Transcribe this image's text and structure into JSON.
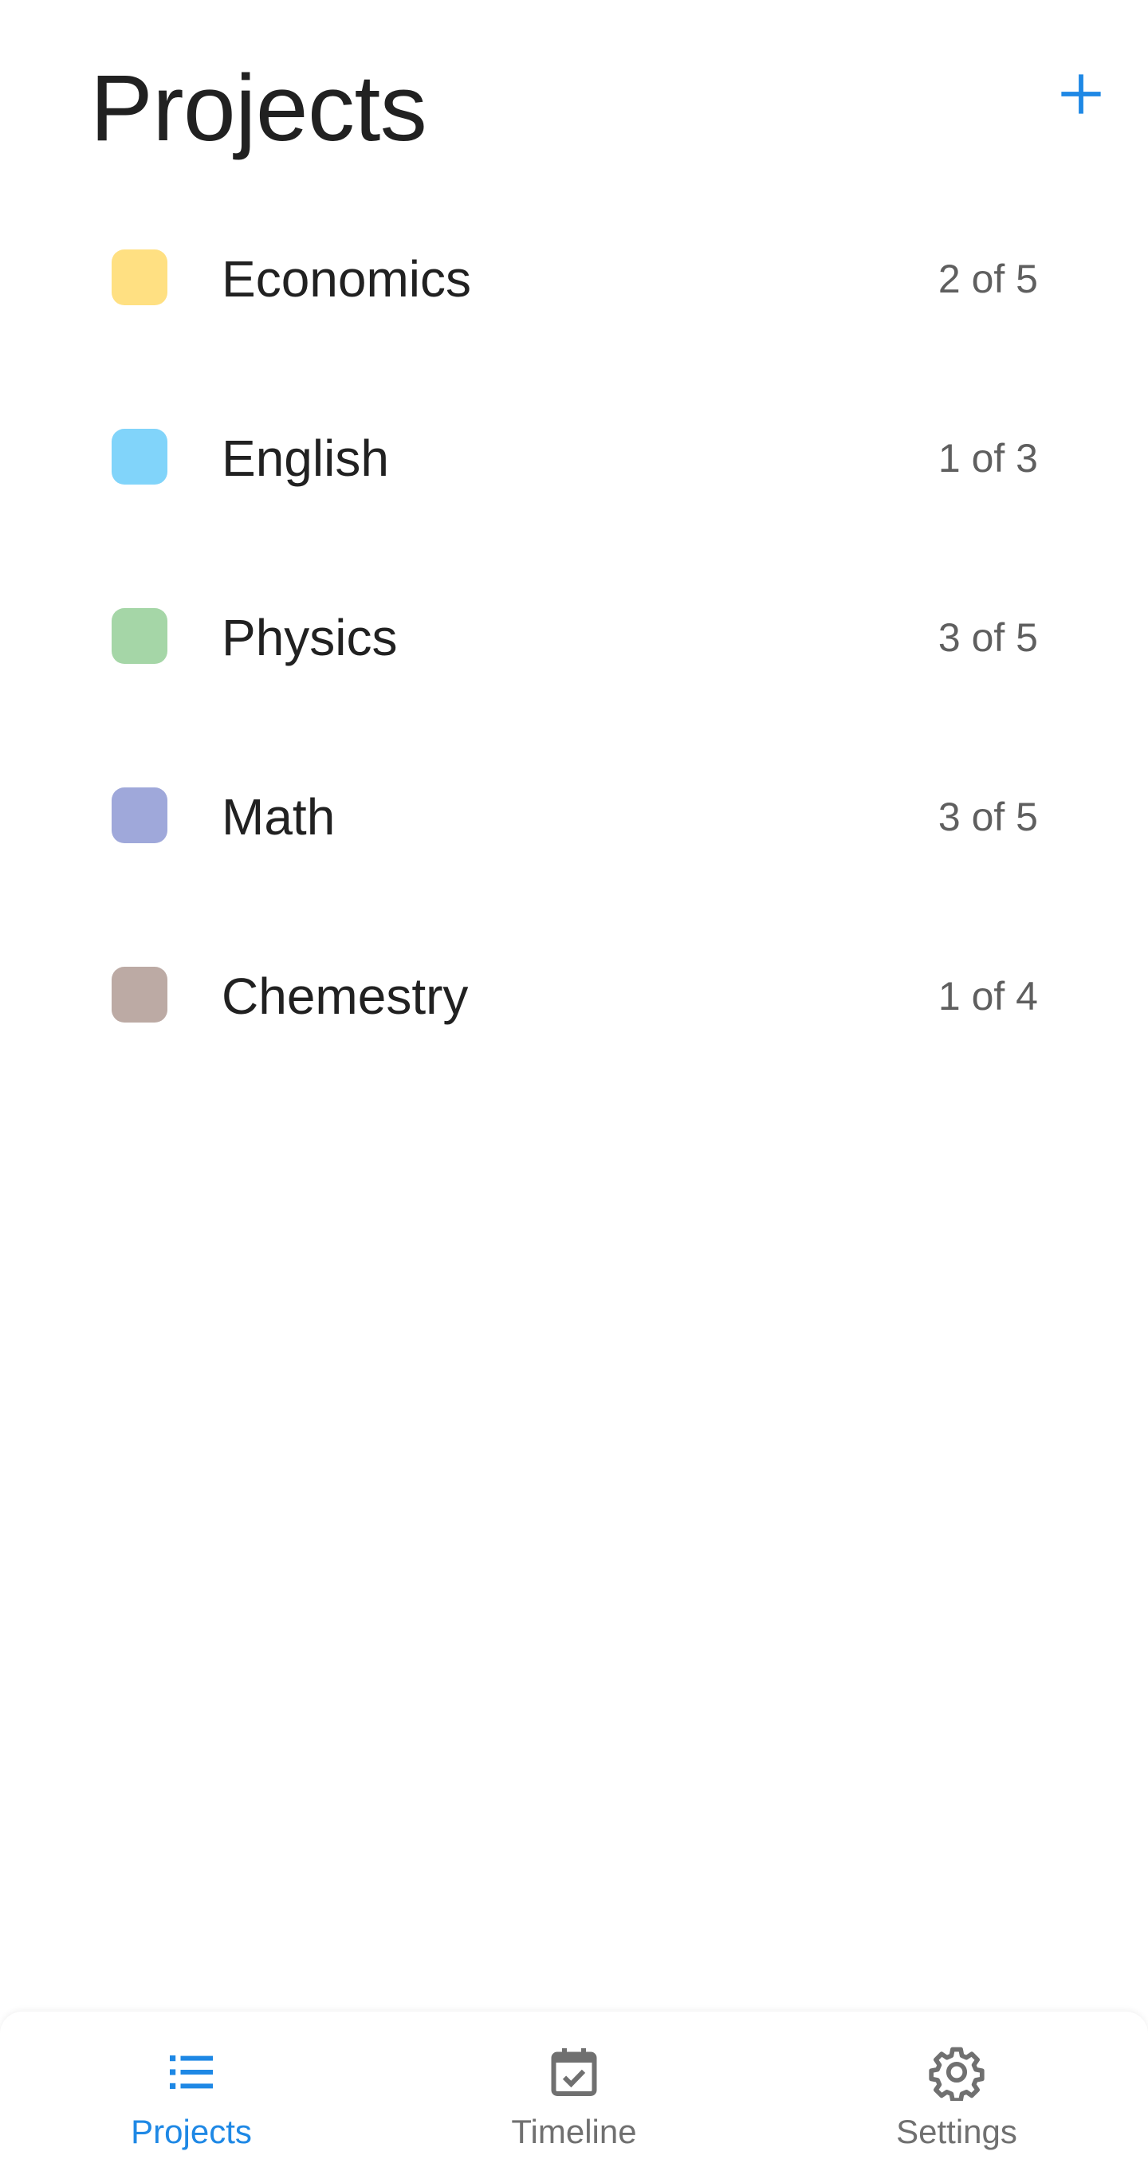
{
  "header": {
    "title": "Projects",
    "add_icon": "plus-icon"
  },
  "colors": {
    "accent": "#1E88E5",
    "text_primary": "#212121",
    "text_secondary": "#5F5F5F",
    "nav_inactive": "#707070"
  },
  "projects": [
    {
      "name": "Economics",
      "count": "2 of 5",
      "color": "#FFE082"
    },
    {
      "name": "English",
      "count": "1 of 3",
      "color": "#81D4FA"
    },
    {
      "name": "Physics",
      "count": "3 of 5",
      "color": "#A5D6A7"
    },
    {
      "name": "Math",
      "count": "3 of 5",
      "color": "#9FA8DA"
    },
    {
      "name": "Chemestry",
      "count": "1 of 4",
      "color": "#BCAAA4"
    }
  ],
  "bottom_nav": {
    "items": [
      {
        "label": "Projects",
        "icon": "list-icon",
        "active": true
      },
      {
        "label": "Timeline",
        "icon": "calendar-check-icon",
        "active": false
      },
      {
        "label": "Settings",
        "icon": "gear-icon",
        "active": false
      }
    ]
  }
}
